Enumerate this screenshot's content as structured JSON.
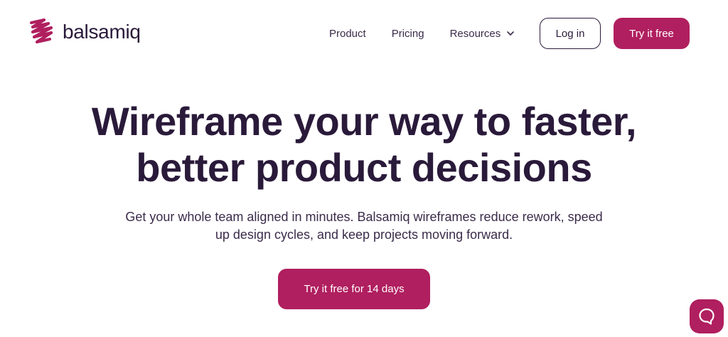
{
  "brand": {
    "name": "balsamiq",
    "logo_icon": "balsamiq-scribble-logo",
    "accent_color": "#b01f5f",
    "text_color": "#2a1a3a"
  },
  "nav": {
    "items": [
      {
        "label": "Product"
      },
      {
        "label": "Pricing"
      },
      {
        "label": "Resources",
        "icon": "chevron-down-icon"
      }
    ],
    "login_label": "Log in",
    "try_label": "Try it free"
  },
  "hero": {
    "title_lines": [
      "Wireframe your way to faster,",
      "better product decisions"
    ],
    "subtitle_lines": [
      "Get your whole team aligned in minutes. Balsamiq wireframes reduce rework, speed",
      "up design cycles, and keep projects moving forward."
    ],
    "cta_label": "Try it free for 14 days"
  },
  "chat_widget": {
    "icon": "chat-bubble-icon"
  }
}
